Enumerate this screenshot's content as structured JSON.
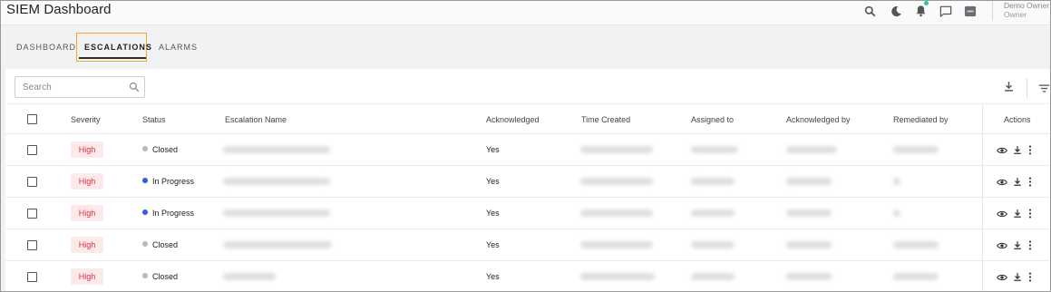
{
  "app": {
    "title": "SIEM Dashboard"
  },
  "header": {
    "icons": [
      "search-icon",
      "moon-icon",
      "bell-icon",
      "chat-icon",
      "app-badge-icon"
    ],
    "notification_dot_color": "#25c4a8",
    "user": {
      "name": "Demo Owner",
      "role": "Owner"
    }
  },
  "tabs": [
    {
      "label": "DASHBOARD",
      "active": false
    },
    {
      "label": "ESCALATIONS",
      "active": true
    },
    {
      "label": "ALARMS",
      "active": false
    }
  ],
  "toolbar": {
    "search_placeholder": "Search",
    "icons": [
      "search-icon",
      "download-icon",
      "filter-icon"
    ]
  },
  "table": {
    "columns": {
      "severity": "Severity",
      "status": "Status",
      "escalation_name": "Escalation Name",
      "acknowledged": "Acknowledged",
      "time_created": "Time Created",
      "assigned_to": "Assigned to",
      "acknowledged_by": "Acknowledged by",
      "remediated_by": "Remediated by",
      "actions": "Actions"
    },
    "rows": [
      {
        "severity": "High",
        "status": "Closed",
        "status_type": "closed",
        "acknowledged": "Yes"
      },
      {
        "severity": "High",
        "status": "In Progress",
        "status_type": "progress",
        "acknowledged": "Yes"
      },
      {
        "severity": "High",
        "status": "In Progress",
        "status_type": "progress",
        "acknowledged": "Yes"
      },
      {
        "severity": "High",
        "status": "Closed",
        "status_type": "closed",
        "acknowledged": "Yes"
      },
      {
        "severity": "High",
        "status": "Closed",
        "status_type": "closed",
        "acknowledged": "Yes"
      }
    ],
    "row_action_icons": [
      "eye-icon",
      "download-icon",
      "more-vertical-icon"
    ]
  },
  "colors": {
    "severity_high_bg": "#fde8ea",
    "severity_high_text": "#d8323e",
    "status_closed": "#b9b9b9",
    "status_in_progress": "#2f5fe0",
    "active_tab_highlight": "#f0a830"
  }
}
